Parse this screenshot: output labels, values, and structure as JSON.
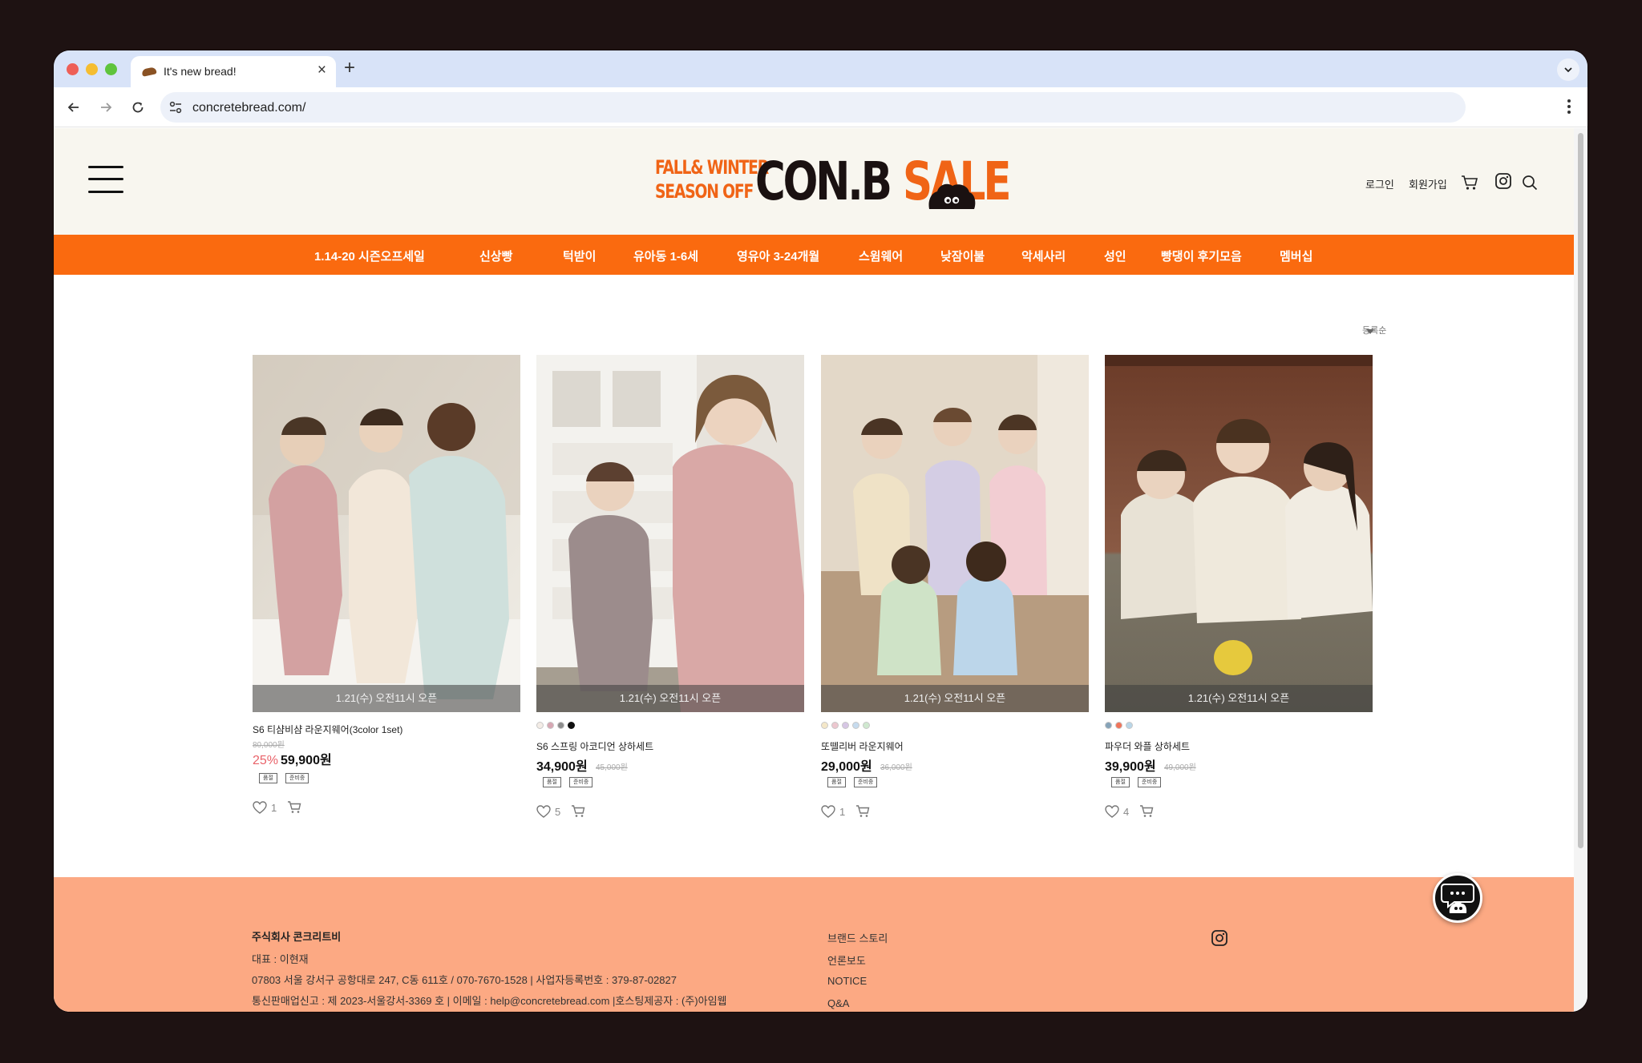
{
  "browser": {
    "tab_title": "It's new bread!",
    "url": "concretebread.com/"
  },
  "header": {
    "logo": {
      "line1": "FALL& WINTER",
      "line2": "SEASON OFF",
      "brand": "CON.B",
      "word": "SALE"
    },
    "login": "로그인",
    "signup": "회원가입"
  },
  "nav": {
    "items": [
      "1.14-20 시즌오프세일",
      "신상빵",
      "턱받이",
      "유아동 1-6세",
      "영유아 3-24개월",
      "스윔웨어",
      "낮잠이불",
      "악세사리",
      "성인",
      "빵댕이 후기모음",
      "멤버십"
    ]
  },
  "sort": {
    "selected": "등록순"
  },
  "products": [
    {
      "name": "S6 티샴비샴 라운지웨어(3color 1set)",
      "original_price": "80,000원",
      "discount": "25%",
      "price": "59,900원",
      "badge": "1.21(수) 오전11시 오픈",
      "chips": [
        "품절",
        "준비중"
      ],
      "likes": "1",
      "swatches": []
    },
    {
      "name": "S6 스프링 아코디언 상하세트",
      "original_price": "45,000원",
      "price": "34,900원",
      "badge": "1.21(수) 오전11시 오픈",
      "chips": [
        "품절",
        "준비중"
      ],
      "likes": "5",
      "swatches": [
        "#f3ece6",
        "#d7a7b3",
        "#8c8c8c",
        "#111111"
      ]
    },
    {
      "name": "또뗄리버 라운지웨어",
      "original_price": "36,000원",
      "price": "29,000원",
      "badge": "1.21(수) 오전11시 오픈",
      "chips": [
        "품절",
        "준비중"
      ],
      "likes": "1",
      "swatches": [
        "#f4e7c8",
        "#ecc7cf",
        "#d6c6e4",
        "#c6dbee",
        "#cfe8cf"
      ]
    },
    {
      "name": "파우더 와플 상하세트",
      "original_price": "49,000원",
      "price": "39,900원",
      "badge": "1.21(수) 오전11시 오픈",
      "chips": [
        "품절",
        "준비중"
      ],
      "likes": "4",
      "swatches": [
        "#86a3b8",
        "#f0745a",
        "#b9d6e8"
      ]
    }
  ],
  "footer": {
    "company": "주식회사 콘크리트비",
    "ceo": "대표 : 이현재",
    "address": "07803 서울 강서구 공항대로 247, C동 611호 / 070-7670-1528 | 사업자등록번호 : 379-87-02827",
    "license": "통신판매업신고 : 제 2023-서울강서-3369 호 | 이메일 : help@concretebread.com |호스팅제공자 : (주)아임웹",
    "links": [
      "브랜드 스토리",
      "언론보도",
      "NOTICE",
      "Q&A"
    ]
  },
  "colors": {
    "accent": "#fa6a0f",
    "footer": "#fca983",
    "discount": "#e9636a"
  }
}
